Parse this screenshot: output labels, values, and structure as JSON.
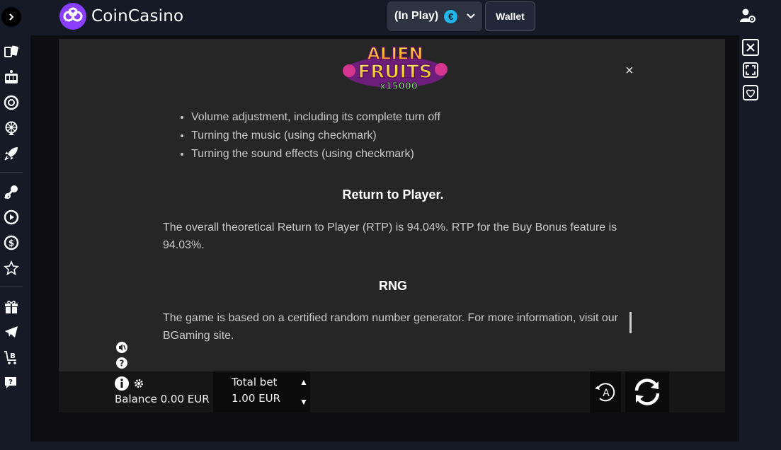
{
  "header": {
    "brand": "CoinCasino",
    "balance_label": "(In Play)",
    "currency_symbol": "€",
    "wallet_label": "Wallet"
  },
  "game": {
    "logo_line1": "ALIEN",
    "logo_line2": "FRUITS",
    "logo_line3": "x15000",
    "close_symbol": "×",
    "rules": {
      "bullets": [
        "Volume adjustment, including its complete turn off",
        "Turning the music (using checkmark)",
        "Turning the sound effects (using checkmark)"
      ],
      "rtp_heading": "Return to Player.",
      "rtp_text": "The overall theoretical Return to Player (RTP) is 94.04%. RTP for the Buy Bonus feature is 94.03%.",
      "rng_heading": "RNG",
      "rng_text": "The game is based on a certified random number generator. For more information, visit our BGaming site."
    },
    "bottom_bar": {
      "balance": "Balance 0.00 EUR",
      "total_bet_label": "Total bet",
      "total_bet_value": "1.00 EUR",
      "auto_label": "A",
      "bet_up_symbol": "▲",
      "bet_down_symbol": "▼"
    }
  },
  "colors": {
    "background": "#151a26",
    "accent_purple": "#8a3ffc",
    "euro_badge": "#1fb6ea",
    "panel": "#262626"
  },
  "icons": [
    "chevron-right-icon",
    "cards-icon",
    "slot-machine-icon",
    "roulette-icon",
    "wheel-icon",
    "rocket-icon",
    "sports-icon",
    "live-play-icon",
    "dollar-coin-icon",
    "star-icon",
    "gift-icon",
    "telegram-icon",
    "bitcoin-cart-icon",
    "chat-icon",
    "user-settings-icon",
    "close-box-icon",
    "fullscreen-icon",
    "heart-icon"
  ]
}
